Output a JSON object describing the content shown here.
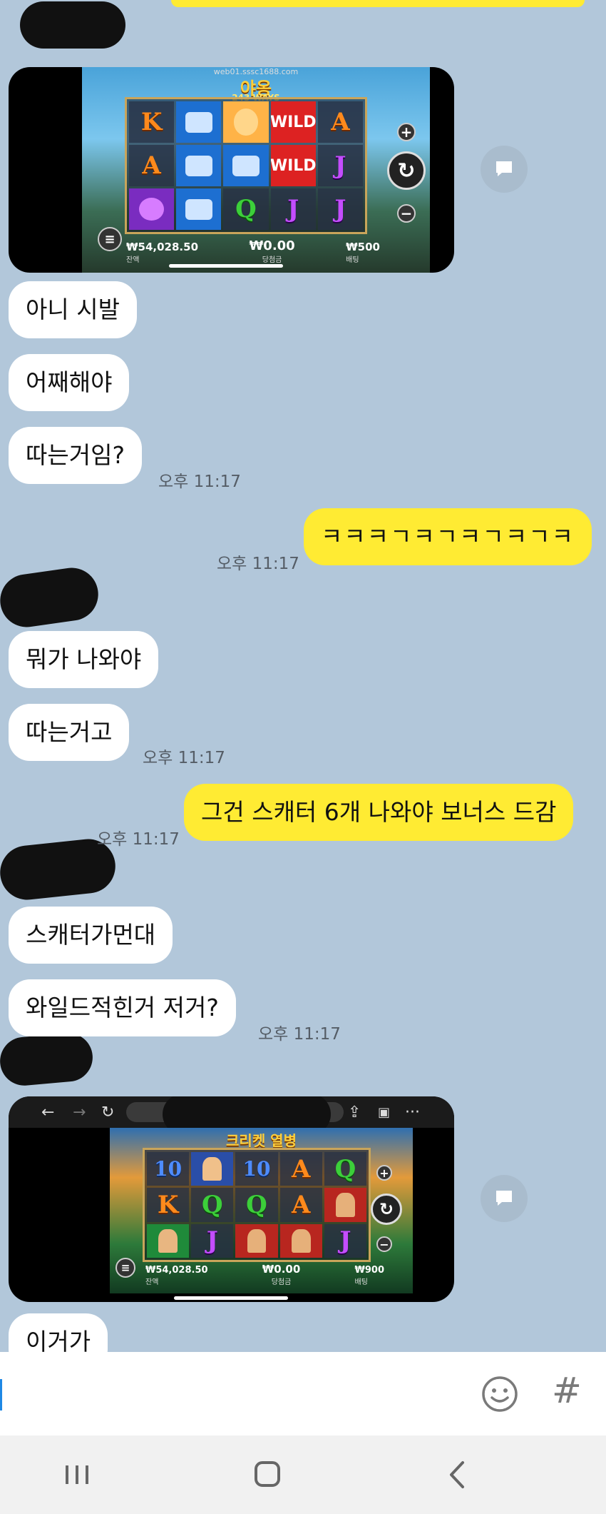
{
  "chat": {
    "messages": [
      {
        "text": "아니 시발"
      },
      {
        "text": "어째해야"
      },
      {
        "text": "따는거임?"
      },
      {
        "text": "ㅋㅋㅋㄱㅋㄱㅋㄱㅋㄱㅋ"
      },
      {
        "text": "뭐가 나와야"
      },
      {
        "text": "따는거고"
      },
      {
        "text": "그건 스캐터 6개 나와야 보너스 드감"
      },
      {
        "text": "스캐터가먼대"
      },
      {
        "text": "와일드적힌거 저거?"
      },
      {
        "text": "이거가"
      }
    ],
    "times": [
      "오후 11:17",
      "오후 11:17",
      "오후 11:17",
      "오후 11:17",
      "오후 11:17"
    ]
  },
  "shot1": {
    "url": "web01.sssc1688.com",
    "title": "야옹",
    "subtitle": "243 WAYS",
    "balance": "₩54,028.50",
    "balance_label": "잔액",
    "win": "₩0.00",
    "win_label": "당첨금",
    "bet": "₩500",
    "bet_label": "배팅",
    "reels": [
      "K",
      "can",
      "cat",
      "WILD",
      "A",
      "A",
      "can",
      "can",
      "WILD",
      "J",
      "ball",
      "can",
      "Q",
      "J",
      "J"
    ]
  },
  "shot2": {
    "title": "크리켓 열병",
    "balance": "₩54,028.50",
    "balance_label": "잔액",
    "win": "₩0.00",
    "win_label": "당첨금",
    "bet": "₩900",
    "bet_label": "배팅",
    "reels": [
      "10",
      "player",
      "10",
      "A",
      "Q",
      "K",
      "Q",
      "Q",
      "A",
      "player2",
      "player3",
      "J",
      "player2",
      "player2",
      "J"
    ]
  },
  "input": {
    "hash_label": "#"
  },
  "icons": {
    "emoji": "emoji-icon",
    "share": "share-icon",
    "nav_recent": "recent-apps-icon",
    "nav_home": "home-icon",
    "nav_back": "back-icon"
  },
  "colors": {
    "background": "#b2c7da",
    "incoming_bubble": "#ffffff",
    "outgoing_bubble": "#ffeb33"
  }
}
